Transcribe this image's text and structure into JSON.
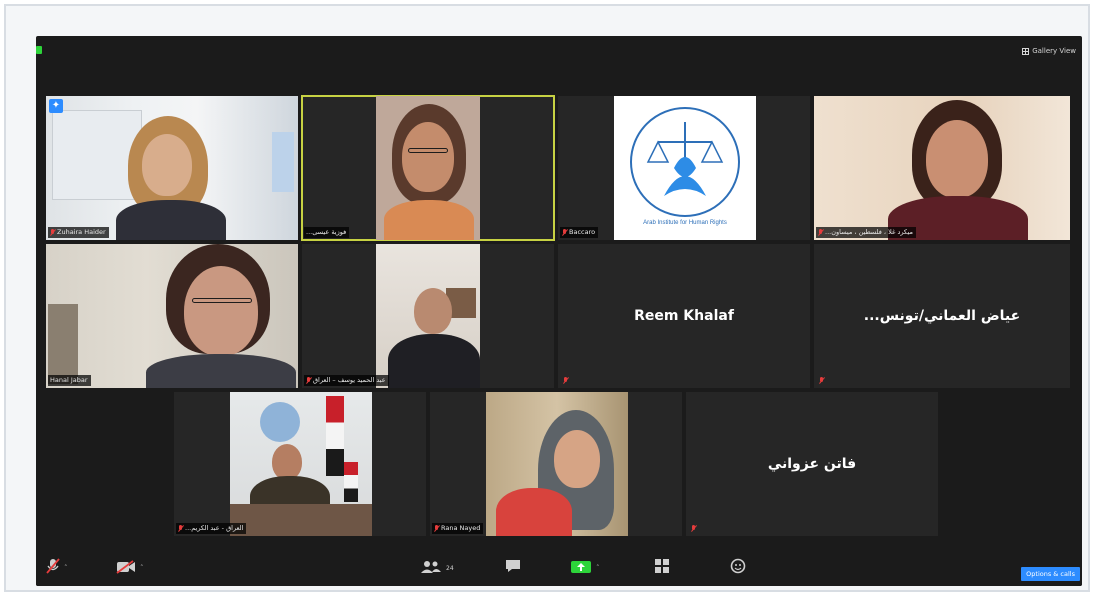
{
  "topbar": {
    "view_label": "Gallery View"
  },
  "tiles": [
    {
      "id": "t1",
      "name": "Zuhaira Haider",
      "muted": true,
      "pinned": true,
      "type": "video"
    },
    {
      "id": "t2",
      "name": "...فوزية عيسى",
      "muted": false,
      "type": "video",
      "active": true
    },
    {
      "id": "t3",
      "name": "Baccaro",
      "muted": true,
      "type": "logo",
      "logo_text": "Arab Institute for Human Rights"
    },
    {
      "id": "t4",
      "name": "...ميكرد غلا ، فلسطين ، ميساون",
      "muted": true,
      "type": "video"
    },
    {
      "id": "t5",
      "name": "Hanal Jabar",
      "muted": false,
      "type": "video"
    },
    {
      "id": "t6",
      "name": "عبد الحميد يوسف – العراق",
      "muted": true,
      "type": "video"
    },
    {
      "id": "t7",
      "name": "Reem Khalaf",
      "muted": true,
      "type": "name-only"
    },
    {
      "id": "t8",
      "name": "...عياض العماني/تونس",
      "muted": true,
      "type": "name-only"
    },
    {
      "id": "t9",
      "name": "...العراق - عبد الكريم",
      "muted": true,
      "type": "video"
    },
    {
      "id": "t10",
      "name": "Rana Nayed",
      "muted": true,
      "type": "video"
    },
    {
      "id": "t11",
      "name": "فاتن عزواني",
      "muted": true,
      "type": "name-only"
    }
  ],
  "toolbar": {
    "mute_icon": "mic-muted-icon",
    "video_icon": "video-off-icon",
    "participants_count": "24",
    "corner_label": "Options & calls"
  },
  "colors": {
    "active_speaker": "#c7d243",
    "muted_red": "#e53c3c",
    "accent_blue": "#2d8cff",
    "share_green": "#2dd43a"
  }
}
